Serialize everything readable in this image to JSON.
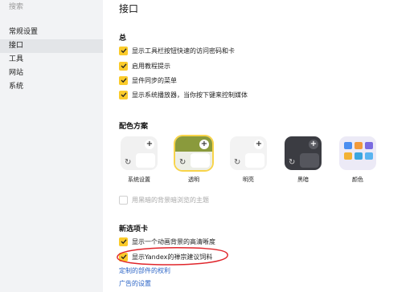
{
  "sidebar": {
    "search_placeholder": "搜索",
    "items": [
      {
        "label": "常规设置",
        "active": false
      },
      {
        "label": "接口",
        "active": true
      },
      {
        "label": "工具",
        "active": false
      },
      {
        "label": "网站",
        "active": false
      },
      {
        "label": "系统",
        "active": false
      }
    ]
  },
  "main": {
    "title": "接口",
    "general": {
      "title": "总",
      "options": [
        {
          "label": "显示工具栏按钮快速的访问密码和卡",
          "checked": true
        },
        {
          "label": "启用教程提示",
          "checked": true
        },
        {
          "label": "显件同步的菜单",
          "checked": true
        },
        {
          "label": "显示系统播放器，当你按下键来控制媒体",
          "checked": true
        }
      ]
    },
    "color_scheme": {
      "title": "配色方案",
      "themes": [
        {
          "name": "系统设置",
          "selected": false
        },
        {
          "name": "透明",
          "selected": true
        },
        {
          "name": "明亮",
          "selected": false
        },
        {
          "name": "黑暗",
          "selected": false
        },
        {
          "name": "颜色",
          "selected": false
        }
      ],
      "dark_background_option": {
        "label": "用黑暗的背景暗浏览的主题",
        "checked": false
      }
    },
    "new_tab": {
      "title": "新选项卡",
      "options": [
        {
          "label": "显示一个动画背景的高清晰度",
          "checked": true
        },
        {
          "label": "显示Yandex的禅宗建议饲料",
          "checked": true
        }
      ],
      "links": [
        "定制的部件的权利",
        "广告的设置"
      ]
    }
  },
  "colors": {
    "accent": "#fbcb2a",
    "link": "#2a63c6",
    "annotation": "#e0252b"
  }
}
